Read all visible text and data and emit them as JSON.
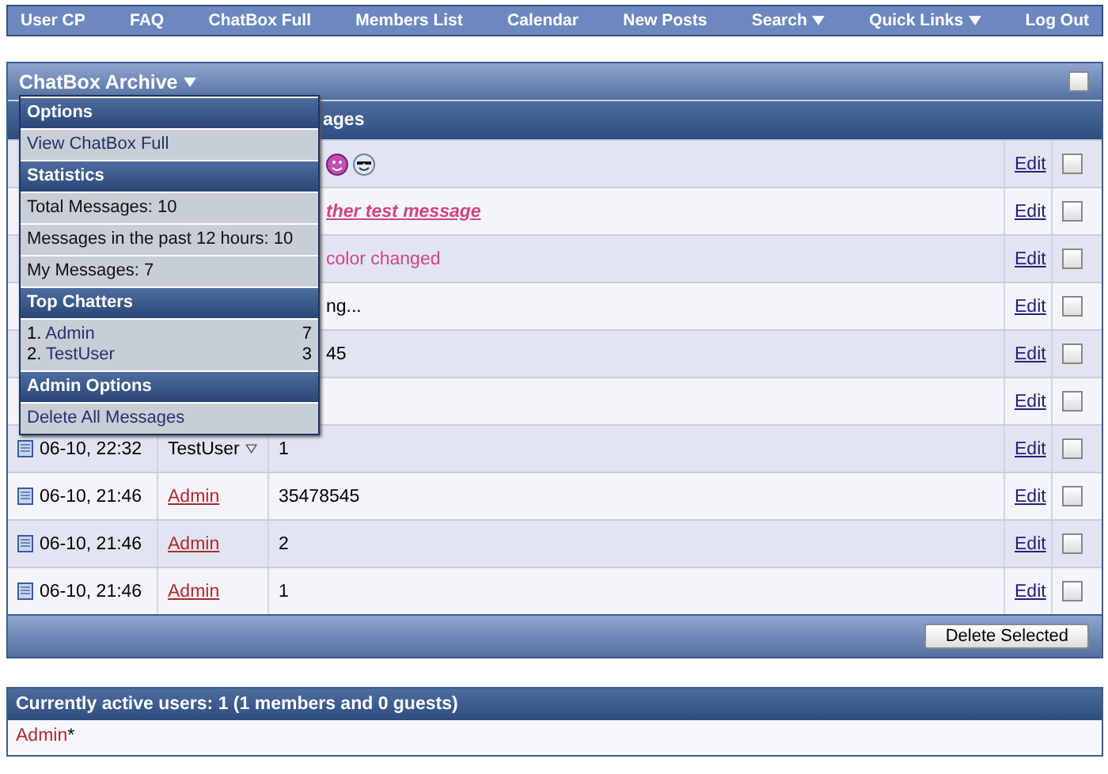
{
  "nav": [
    "User CP",
    "FAQ",
    "ChatBox Full",
    "Members List",
    "Calendar",
    "New Posts",
    {
      "label": "Search",
      "menu": true
    },
    {
      "label": "Quick Links",
      "menu": true
    },
    "Log Out"
  ],
  "archive": {
    "title": "ChatBox Archive",
    "header": "ages",
    "select_all": false,
    "rows": [
      {
        "message": "",
        "kind": "smileys",
        "checked": false,
        "edit": "Edit"
      },
      {
        "message": "ther test message",
        "kind": "pink_link",
        "checked": false,
        "edit": "Edit"
      },
      {
        "message": "color changed",
        "kind": "pink",
        "checked": false,
        "edit": "Edit"
      },
      {
        "message": "ng...",
        "kind": "plain",
        "checked": false,
        "edit": "Edit"
      },
      {
        "message": "45",
        "kind": "plain",
        "checked": false,
        "edit": "Edit"
      },
      {
        "message": "",
        "kind": "plain",
        "checked": false,
        "edit": "Edit"
      },
      {
        "date": "06-10, 22:32",
        "user": {
          "name": "TestUser",
          "kind": "plain"
        },
        "message": "1",
        "kind": "plain",
        "checked": false,
        "edit": "Edit"
      },
      {
        "date": "06-10, 21:46",
        "user": {
          "name": "Admin",
          "kind": "link"
        },
        "message": "35478545",
        "kind": "plain",
        "checked": false,
        "edit": "Edit"
      },
      {
        "date": "06-10, 21:46",
        "user": {
          "name": "Admin",
          "kind": "link"
        },
        "message": "2",
        "kind": "plain",
        "checked": false,
        "edit": "Edit"
      },
      {
        "date": "06-10, 21:46",
        "user": {
          "name": "Admin",
          "kind": "link"
        },
        "message": "1",
        "kind": "plain",
        "checked": false,
        "edit": "Edit"
      }
    ],
    "delete_button": "Delete Selected"
  },
  "menu": [
    {
      "heading": "Options",
      "items": [
        {
          "kind": "link",
          "label": "View ChatBox Full"
        }
      ]
    },
    {
      "heading": "Statistics",
      "items": [
        {
          "kind": "text",
          "label": "Total Messages: 10"
        },
        {
          "kind": "text",
          "label": "Messages in the past 12 hours: 10"
        },
        {
          "kind": "text",
          "label": "My Messages: 7"
        }
      ]
    },
    {
      "heading": "Top Chatters",
      "items": [
        {
          "kind": "ranking",
          "entries": [
            {
              "rank": "1.",
              "name": "Admin",
              "count": "7"
            },
            {
              "rank": "2.",
              "name": "TestUser",
              "count": "3"
            }
          ]
        }
      ]
    },
    {
      "heading": "Admin Options",
      "items": [
        {
          "kind": "link",
          "label": "Delete All Messages"
        }
      ]
    }
  ],
  "active_users": {
    "title": "Currently active users: 1 (1 members and 0 guests)",
    "users": [
      {
        "name": "Admin",
        "mark": "*"
      }
    ]
  }
}
